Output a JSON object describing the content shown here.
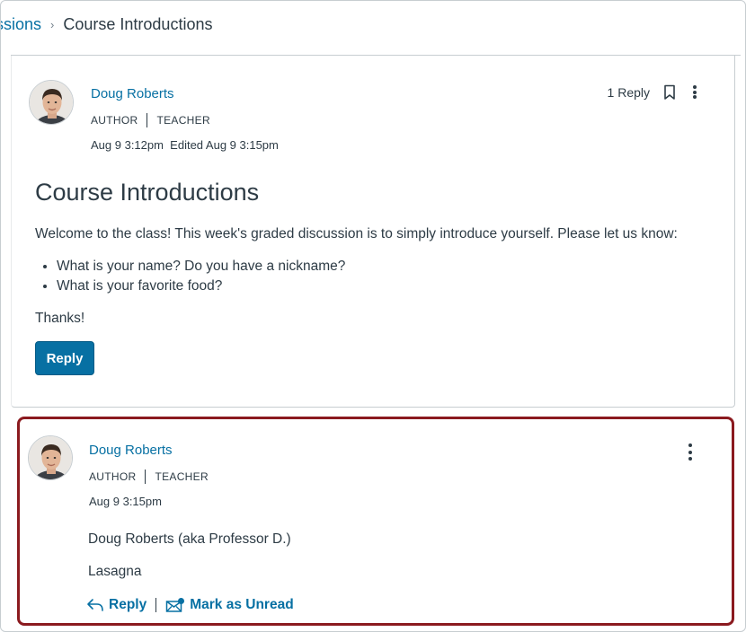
{
  "breadcrumb": {
    "parent": "ussions",
    "separator": "›",
    "current": "Course Introductions"
  },
  "topic": {
    "author": "Doug Roberts",
    "role_primary": "AUTHOR",
    "role_secondary": "TEACHER",
    "timestamp": "Aug 9 3:12pm  Edited Aug 9 3:15pm",
    "reply_count": "1 Reply",
    "title": "Course Introductions",
    "intro": "Welcome to the class! This week's graded discussion is to simply introduce yourself. Please let us know:",
    "bullets": [
      "What is your name? Do you have a nickname?",
      "What is your favorite food?"
    ],
    "closing": "Thanks!",
    "reply_button": "Reply"
  },
  "reply": {
    "author": "Doug Roberts",
    "role_primary": "AUTHOR",
    "role_secondary": "TEACHER",
    "timestamp": "Aug 9 3:15pm",
    "lines": [
      "Doug Roberts (aka Professor D.)",
      "Lasagna"
    ],
    "reply_action": "Reply",
    "mark_unread_action": "Mark as Unread"
  },
  "icons": {
    "bookmark": "bookmark-icon",
    "more_options": "kebab-menu-icon",
    "reply_arrow": "reply-arrow-icon",
    "mark_unread": "mail-unread-icon",
    "avatar": "user-avatar"
  },
  "colors": {
    "link": "#0770a3",
    "primary_button": "#0770a3",
    "highlight_border": "#8b1a1f",
    "text": "#2d3b45"
  }
}
